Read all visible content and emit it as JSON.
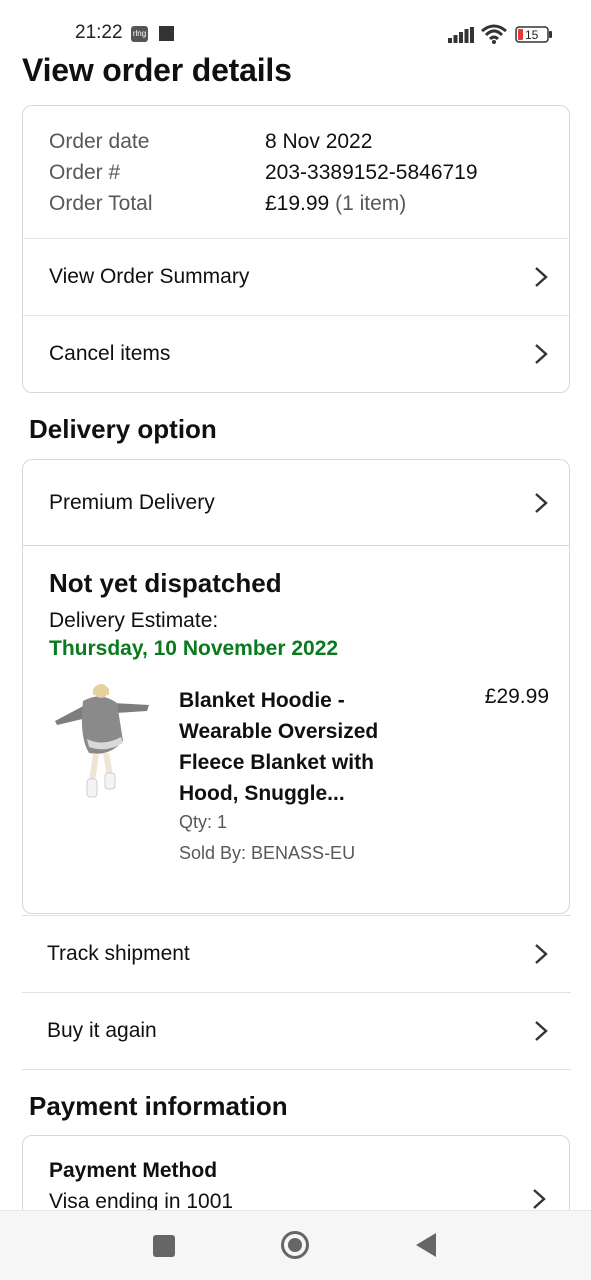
{
  "status_bar": {
    "time": "21:22",
    "badge": "rlng",
    "battery": "15",
    "icons": [
      "signal-icon",
      "wifi-icon",
      "battery-icon"
    ]
  },
  "page": {
    "title": "View order details"
  },
  "order_info": {
    "rows": [
      {
        "label": "Order date",
        "value": "8 Nov 2022",
        "extra": ""
      },
      {
        "label": "Order #",
        "value": "203-3389152-5846719",
        "extra": ""
      },
      {
        "label": "Order Total",
        "value": "£19.99",
        "extra": "(1 item)"
      }
    ],
    "links": [
      {
        "label": "View Order Summary"
      },
      {
        "label": "Cancel items"
      }
    ]
  },
  "delivery": {
    "section_title": "Delivery option",
    "option_label": "Premium Delivery",
    "status": "Not yet dispatched",
    "estimate_label": "Delivery Estimate:",
    "estimate_date": "Thursday, 10 November 2022",
    "colors": {
      "estimate_date": "#0a7a1f"
    }
  },
  "product": {
    "title": "Blanket Hoodie - Wearable Oversized Fleece Blanket with Hood, Snuggle...",
    "price": "£29.99",
    "qty": "Qty: 1",
    "seller": "Sold By: BENASS-EU"
  },
  "actions": [
    {
      "label": "Track shipment"
    },
    {
      "label": "Buy it again"
    }
  ],
  "payment": {
    "section_title": "Payment information",
    "method_title": "Payment Method",
    "method_value": "Visa ending in 1001"
  },
  "nav_bar": {
    "icons": [
      "recents-icon",
      "home-icon",
      "back-icon"
    ]
  }
}
